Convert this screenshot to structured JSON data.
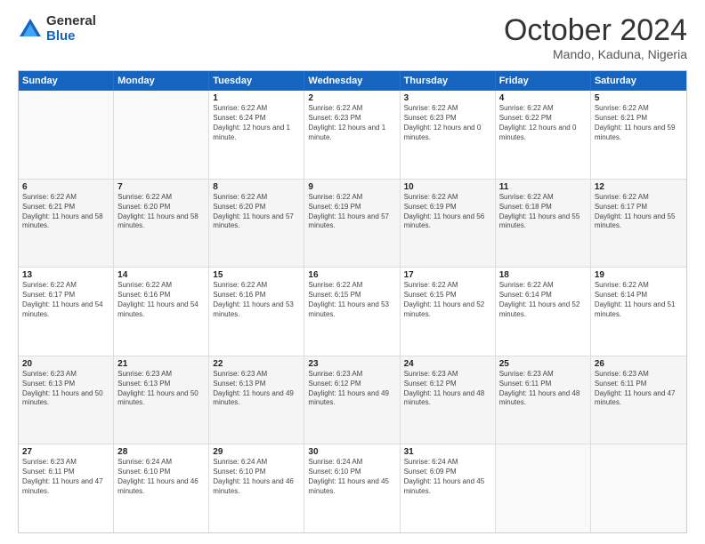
{
  "logo": {
    "general": "General",
    "blue": "Blue"
  },
  "title": {
    "month_year": "October 2024",
    "location": "Mando, Kaduna, Nigeria"
  },
  "days": [
    "Sunday",
    "Monday",
    "Tuesday",
    "Wednesday",
    "Thursday",
    "Friday",
    "Saturday"
  ],
  "weeks": [
    [
      {
        "day": "",
        "sunrise": "",
        "sunset": "",
        "daylight": "",
        "empty": true
      },
      {
        "day": "",
        "sunrise": "",
        "sunset": "",
        "daylight": "",
        "empty": true
      },
      {
        "day": "1",
        "sunrise": "Sunrise: 6:22 AM",
        "sunset": "Sunset: 6:24 PM",
        "daylight": "Daylight: 12 hours and 1 minute.",
        "empty": false
      },
      {
        "day": "2",
        "sunrise": "Sunrise: 6:22 AM",
        "sunset": "Sunset: 6:23 PM",
        "daylight": "Daylight: 12 hours and 1 minute.",
        "empty": false
      },
      {
        "day": "3",
        "sunrise": "Sunrise: 6:22 AM",
        "sunset": "Sunset: 6:23 PM",
        "daylight": "Daylight: 12 hours and 0 minutes.",
        "empty": false
      },
      {
        "day": "4",
        "sunrise": "Sunrise: 6:22 AM",
        "sunset": "Sunset: 6:22 PM",
        "daylight": "Daylight: 12 hours and 0 minutes.",
        "empty": false
      },
      {
        "day": "5",
        "sunrise": "Sunrise: 6:22 AM",
        "sunset": "Sunset: 6:21 PM",
        "daylight": "Daylight: 11 hours and 59 minutes.",
        "empty": false
      }
    ],
    [
      {
        "day": "6",
        "sunrise": "Sunrise: 6:22 AM",
        "sunset": "Sunset: 6:21 PM",
        "daylight": "Daylight: 11 hours and 58 minutes.",
        "empty": false
      },
      {
        "day": "7",
        "sunrise": "Sunrise: 6:22 AM",
        "sunset": "Sunset: 6:20 PM",
        "daylight": "Daylight: 11 hours and 58 minutes.",
        "empty": false
      },
      {
        "day": "8",
        "sunrise": "Sunrise: 6:22 AM",
        "sunset": "Sunset: 6:20 PM",
        "daylight": "Daylight: 11 hours and 57 minutes.",
        "empty": false
      },
      {
        "day": "9",
        "sunrise": "Sunrise: 6:22 AM",
        "sunset": "Sunset: 6:19 PM",
        "daylight": "Daylight: 11 hours and 57 minutes.",
        "empty": false
      },
      {
        "day": "10",
        "sunrise": "Sunrise: 6:22 AM",
        "sunset": "Sunset: 6:19 PM",
        "daylight": "Daylight: 11 hours and 56 minutes.",
        "empty": false
      },
      {
        "day": "11",
        "sunrise": "Sunrise: 6:22 AM",
        "sunset": "Sunset: 6:18 PM",
        "daylight": "Daylight: 11 hours and 55 minutes.",
        "empty": false
      },
      {
        "day": "12",
        "sunrise": "Sunrise: 6:22 AM",
        "sunset": "Sunset: 6:17 PM",
        "daylight": "Daylight: 11 hours and 55 minutes.",
        "empty": false
      }
    ],
    [
      {
        "day": "13",
        "sunrise": "Sunrise: 6:22 AM",
        "sunset": "Sunset: 6:17 PM",
        "daylight": "Daylight: 11 hours and 54 minutes.",
        "empty": false
      },
      {
        "day": "14",
        "sunrise": "Sunrise: 6:22 AM",
        "sunset": "Sunset: 6:16 PM",
        "daylight": "Daylight: 11 hours and 54 minutes.",
        "empty": false
      },
      {
        "day": "15",
        "sunrise": "Sunrise: 6:22 AM",
        "sunset": "Sunset: 6:16 PM",
        "daylight": "Daylight: 11 hours and 53 minutes.",
        "empty": false
      },
      {
        "day": "16",
        "sunrise": "Sunrise: 6:22 AM",
        "sunset": "Sunset: 6:15 PM",
        "daylight": "Daylight: 11 hours and 53 minutes.",
        "empty": false
      },
      {
        "day": "17",
        "sunrise": "Sunrise: 6:22 AM",
        "sunset": "Sunset: 6:15 PM",
        "daylight": "Daylight: 11 hours and 52 minutes.",
        "empty": false
      },
      {
        "day": "18",
        "sunrise": "Sunrise: 6:22 AM",
        "sunset": "Sunset: 6:14 PM",
        "daylight": "Daylight: 11 hours and 52 minutes.",
        "empty": false
      },
      {
        "day": "19",
        "sunrise": "Sunrise: 6:22 AM",
        "sunset": "Sunset: 6:14 PM",
        "daylight": "Daylight: 11 hours and 51 minutes.",
        "empty": false
      }
    ],
    [
      {
        "day": "20",
        "sunrise": "Sunrise: 6:23 AM",
        "sunset": "Sunset: 6:13 PM",
        "daylight": "Daylight: 11 hours and 50 minutes.",
        "empty": false
      },
      {
        "day": "21",
        "sunrise": "Sunrise: 6:23 AM",
        "sunset": "Sunset: 6:13 PM",
        "daylight": "Daylight: 11 hours and 50 minutes.",
        "empty": false
      },
      {
        "day": "22",
        "sunrise": "Sunrise: 6:23 AM",
        "sunset": "Sunset: 6:13 PM",
        "daylight": "Daylight: 11 hours and 49 minutes.",
        "empty": false
      },
      {
        "day": "23",
        "sunrise": "Sunrise: 6:23 AM",
        "sunset": "Sunset: 6:12 PM",
        "daylight": "Daylight: 11 hours and 49 minutes.",
        "empty": false
      },
      {
        "day": "24",
        "sunrise": "Sunrise: 6:23 AM",
        "sunset": "Sunset: 6:12 PM",
        "daylight": "Daylight: 11 hours and 48 minutes.",
        "empty": false
      },
      {
        "day": "25",
        "sunrise": "Sunrise: 6:23 AM",
        "sunset": "Sunset: 6:11 PM",
        "daylight": "Daylight: 11 hours and 48 minutes.",
        "empty": false
      },
      {
        "day": "26",
        "sunrise": "Sunrise: 6:23 AM",
        "sunset": "Sunset: 6:11 PM",
        "daylight": "Daylight: 11 hours and 47 minutes.",
        "empty": false
      }
    ],
    [
      {
        "day": "27",
        "sunrise": "Sunrise: 6:23 AM",
        "sunset": "Sunset: 6:11 PM",
        "daylight": "Daylight: 11 hours and 47 minutes.",
        "empty": false
      },
      {
        "day": "28",
        "sunrise": "Sunrise: 6:24 AM",
        "sunset": "Sunset: 6:10 PM",
        "daylight": "Daylight: 11 hours and 46 minutes.",
        "empty": false
      },
      {
        "day": "29",
        "sunrise": "Sunrise: 6:24 AM",
        "sunset": "Sunset: 6:10 PM",
        "daylight": "Daylight: 11 hours and 46 minutes.",
        "empty": false
      },
      {
        "day": "30",
        "sunrise": "Sunrise: 6:24 AM",
        "sunset": "Sunset: 6:10 PM",
        "daylight": "Daylight: 11 hours and 45 minutes.",
        "empty": false
      },
      {
        "day": "31",
        "sunrise": "Sunrise: 6:24 AM",
        "sunset": "Sunset: 6:09 PM",
        "daylight": "Daylight: 11 hours and 45 minutes.",
        "empty": false
      },
      {
        "day": "",
        "sunrise": "",
        "sunset": "",
        "daylight": "",
        "empty": true
      },
      {
        "day": "",
        "sunrise": "",
        "sunset": "",
        "daylight": "",
        "empty": true
      }
    ]
  ]
}
